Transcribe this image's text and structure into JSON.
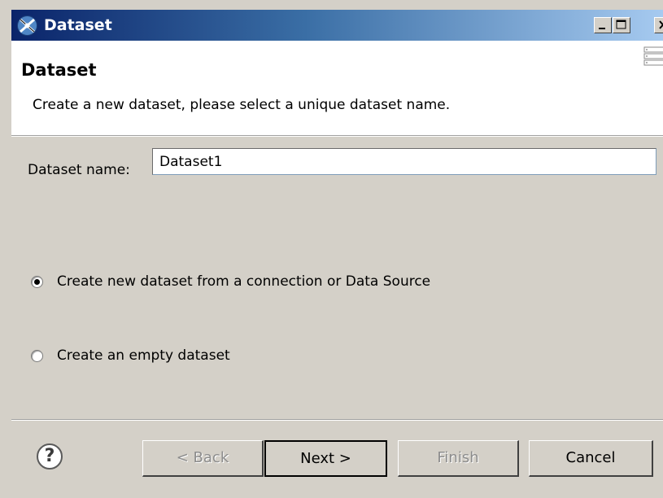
{
  "window": {
    "title": "Dataset",
    "controls": {
      "minimize": "minimize",
      "maximize": "maximize",
      "close": "close"
    }
  },
  "header": {
    "title": "Dataset",
    "description": "Create a new dataset, please select a unique dataset name."
  },
  "form": {
    "name_label": "Dataset name:",
    "name_value": "Dataset1"
  },
  "options": [
    {
      "label": "Create new dataset from a connection or Data Source",
      "selected": true
    },
    {
      "label": "Create an empty dataset",
      "selected": false
    }
  ],
  "footer": {
    "help_label": "?",
    "back_label": "< Back",
    "back_enabled": false,
    "next_label": "Next >",
    "next_enabled": true,
    "finish_label": "Finish",
    "finish_enabled": false,
    "cancel_label": "Cancel",
    "cancel_enabled": true
  },
  "colors": {
    "titlebar_start": "#0a246a",
    "titlebar_end": "#a6caf0",
    "dialog_bg": "#d4d0c8",
    "header_bg": "#ffffff"
  },
  "icons": {
    "app": "dataset-app-icon",
    "help": "help-icon",
    "header_graphic": "wizard-banner-icon"
  }
}
